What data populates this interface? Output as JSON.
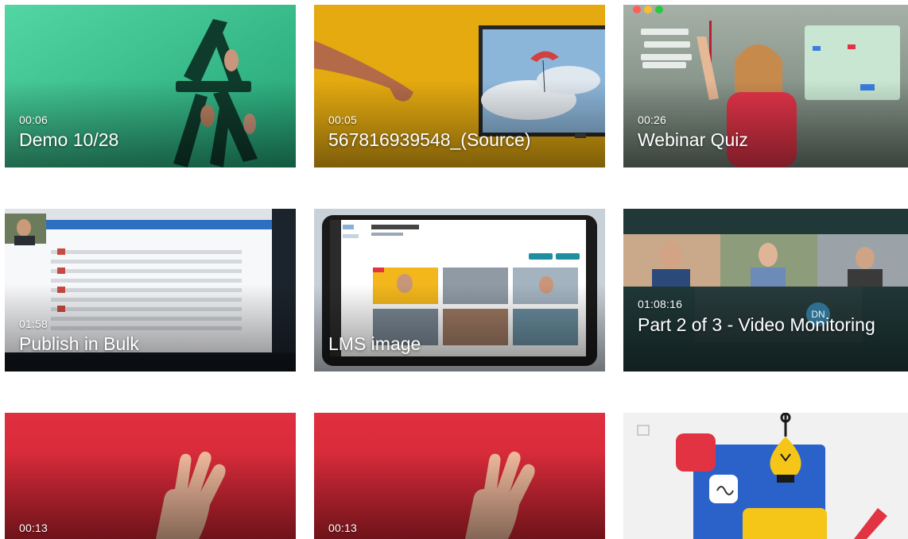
{
  "cards": [
    {
      "duration": "00:06",
      "title": "Demo 10/28",
      "bg": "#35c48f"
    },
    {
      "duration": "00:05",
      "title": "567816939548_(Source)",
      "bg": "#e2a80f"
    },
    {
      "duration": "00:26",
      "title": "Webinar Quiz",
      "bg": "#88958a"
    },
    {
      "duration": "01:58",
      "title": "Publish in Bulk",
      "bg": "#2c3a49"
    },
    {
      "duration": "",
      "title": "LMS image",
      "bg": "#cfd6dd"
    },
    {
      "duration": "01:08:16",
      "title": "Part 2 of 3 - Video Monitoring",
      "bg": "#2c4a4a",
      "avatar_initials": "DN"
    },
    {
      "duration": "00:13",
      "title": "",
      "bg": "#e23342"
    },
    {
      "duration": "00:13",
      "title": "",
      "bg": "#e23342"
    },
    {
      "duration": "",
      "title": "",
      "bg": "#f1f1f1"
    }
  ],
  "icons": {
    "play": "play-icon",
    "image": "image-icon"
  }
}
